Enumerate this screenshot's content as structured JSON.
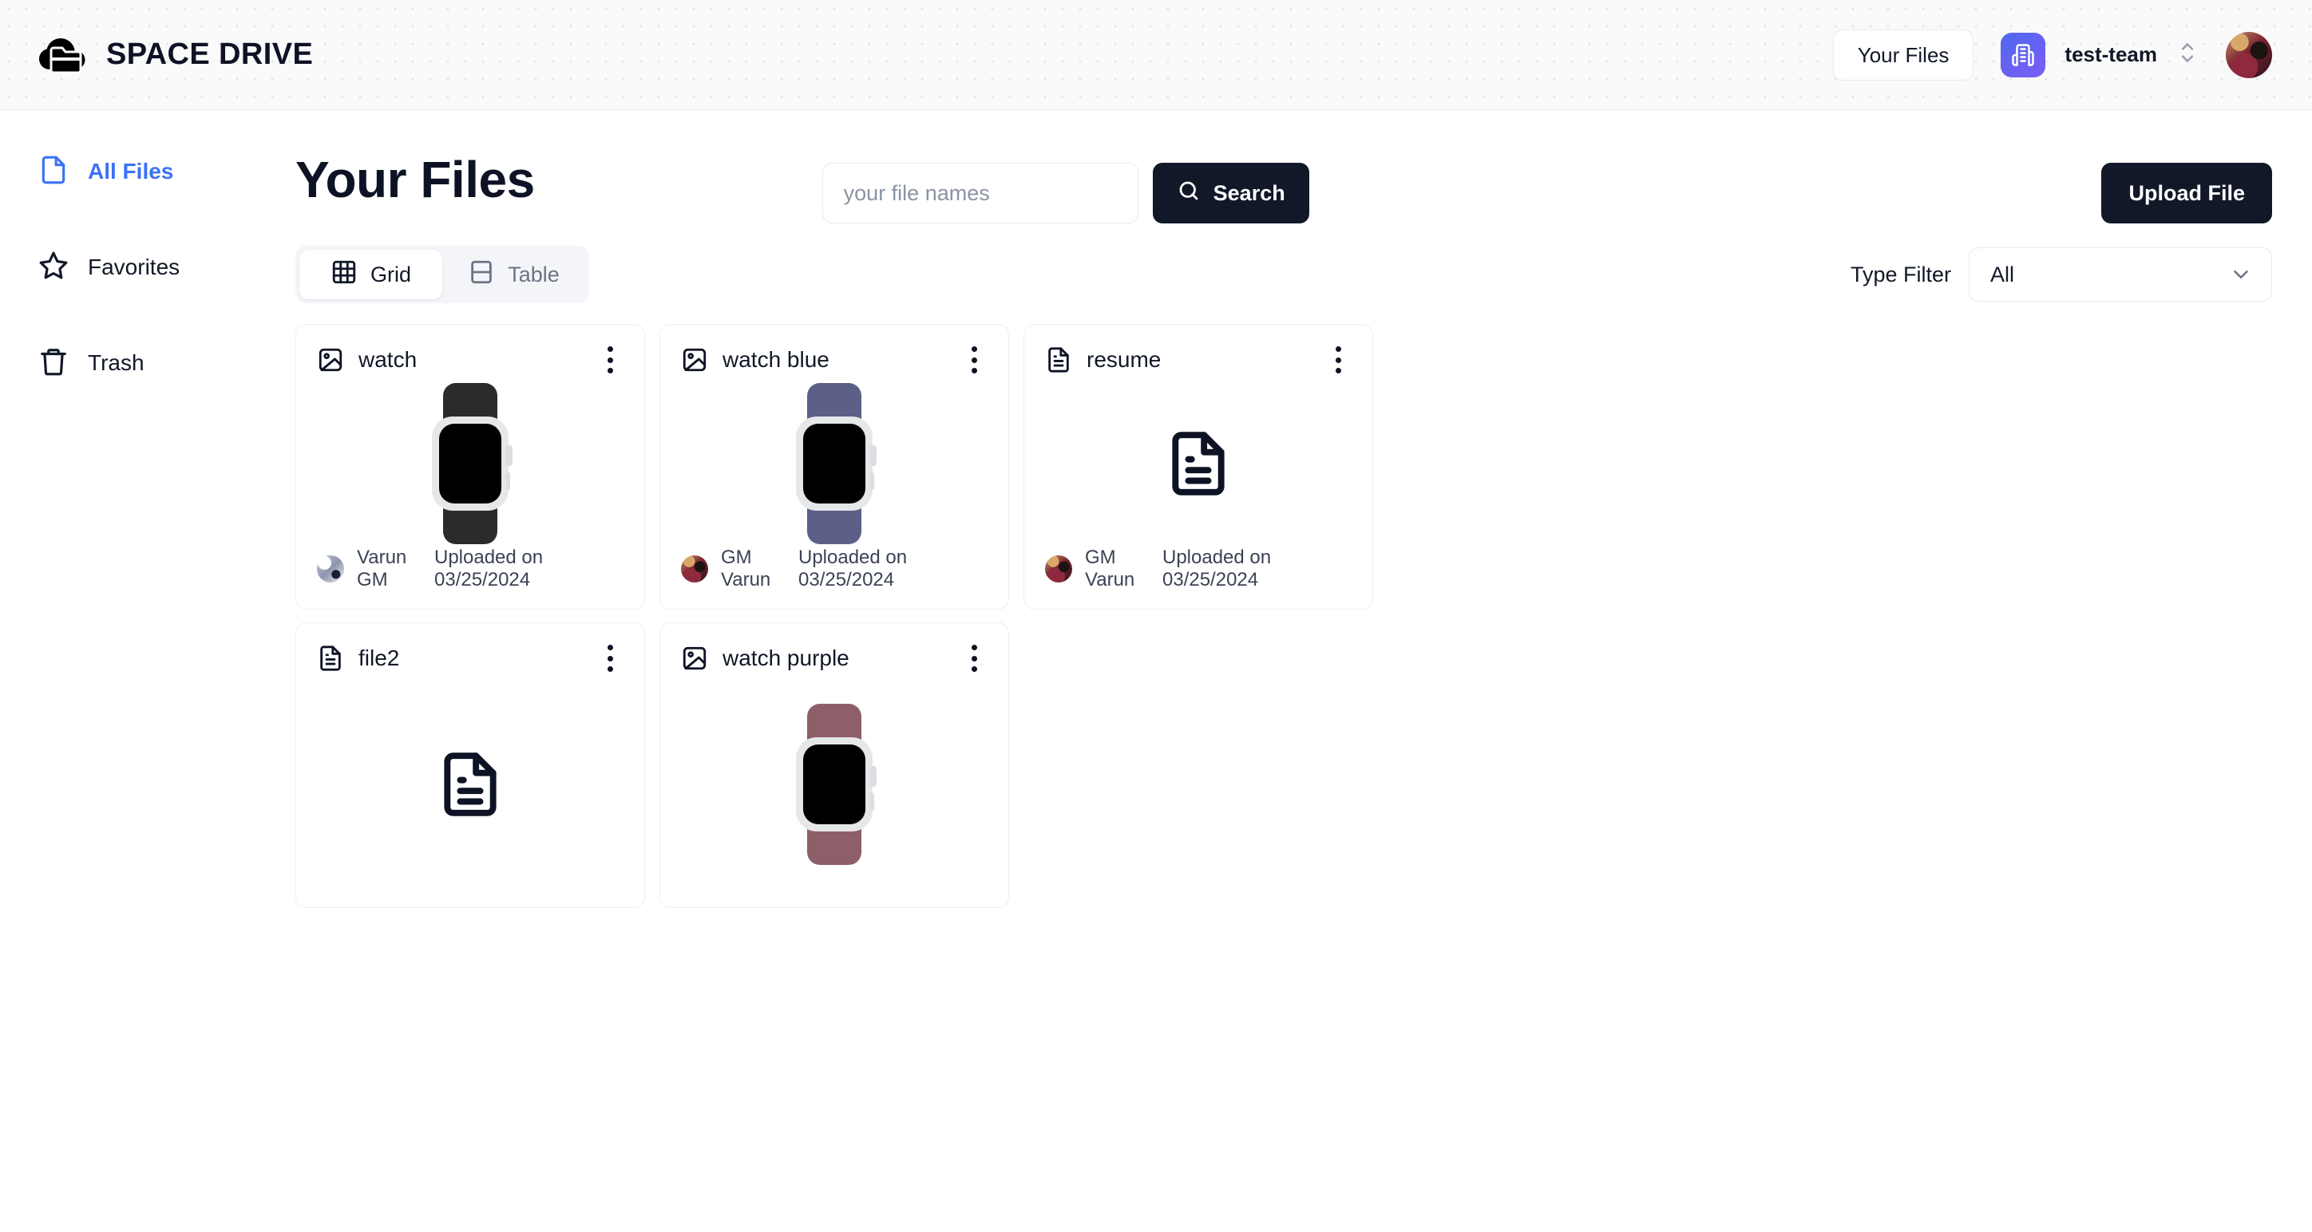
{
  "app": {
    "brand_name": "SPACE DRIVE",
    "logo_icon": "cloud-folder-icon"
  },
  "header": {
    "your_files_label": "Your Files",
    "team_badge_icon": "building-icon",
    "team_name": "test-team",
    "team_switch_icon": "chevrons-up-down-icon",
    "avatar_icon": "user-avatar"
  },
  "sidebar": {
    "items": [
      {
        "label": "All Files",
        "icon": "file-icon",
        "active": true
      },
      {
        "label": "Favorites",
        "icon": "star-icon",
        "active": false
      },
      {
        "label": "Trash",
        "icon": "trash-icon",
        "active": false
      }
    ]
  },
  "main": {
    "page_title": "Your Files",
    "search": {
      "placeholder": "your file names",
      "value": "",
      "button_label": "Search",
      "button_icon": "search-icon"
    },
    "upload_button_label": "Upload File",
    "view_toggle": {
      "options": [
        {
          "label": "Grid",
          "icon": "grid-icon",
          "active": true
        },
        {
          "label": "Table",
          "icon": "table-icon",
          "active": false
        }
      ]
    },
    "type_filter": {
      "label": "Type Filter",
      "selected": "All",
      "chevron_icon": "chevron-down-icon"
    }
  },
  "colors": {
    "accent_blue": "#3b72f6",
    "dark_button": "#111827",
    "team_badge_gradient_start": "#4f68ef",
    "team_badge_gradient_end": "#7c5cf5",
    "card_border": "#eceef3",
    "watch_band_black": "#2b2b2b",
    "watch_band_blue": "#5c6089",
    "watch_band_purple": "#8f5f69",
    "watch_case": "#e6e7e9"
  },
  "files": [
    {
      "name": "watch",
      "type_icon": "image-icon",
      "thumb": "watch",
      "band_color": "#2b2b2b",
      "uploader": "Varun GM",
      "avatar_style": "style-a",
      "uploaded": "Uploaded on 03/25/2024",
      "menu_icon": "kebab-menu-icon"
    },
    {
      "name": "watch blue",
      "type_icon": "image-icon",
      "thumb": "watch",
      "band_color": "#5c6089",
      "uploader": "GM Varun",
      "avatar_style": "style-b",
      "uploaded": "Uploaded on 03/25/2024",
      "menu_icon": "kebab-menu-icon"
    },
    {
      "name": "resume",
      "type_icon": "file-text-icon",
      "thumb": "document",
      "band_color": "",
      "uploader": "GM Varun",
      "avatar_style": "style-b",
      "uploaded": "Uploaded on 03/25/2024",
      "menu_icon": "kebab-menu-icon"
    },
    {
      "name": "file2",
      "type_icon": "file-text-icon",
      "thumb": "document",
      "band_color": "",
      "uploader": "",
      "avatar_style": "style-b",
      "uploaded": "",
      "menu_icon": "kebab-menu-icon"
    },
    {
      "name": "watch purple",
      "type_icon": "image-icon",
      "thumb": "watch",
      "band_color": "#8f5f69",
      "uploader": "",
      "avatar_style": "style-b",
      "uploaded": "",
      "menu_icon": "kebab-menu-icon"
    }
  ]
}
